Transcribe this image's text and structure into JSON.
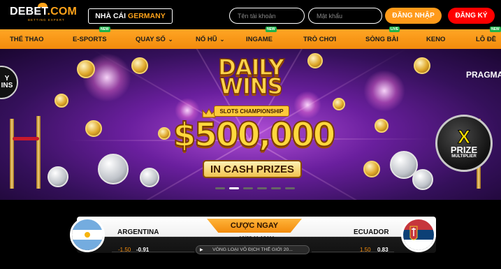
{
  "header": {
    "logo_main": "DEBET",
    "logo_suffix": ".COM",
    "logo_tagline": "BETTING EXPERT",
    "brand_prefix": "NHÀ CÁI",
    "brand_highlight": "GERMANY",
    "username_placeholder": "Tên tài khoản",
    "password_placeholder": "Mật khẩu",
    "login_label": "ĐĂNG NHẬP",
    "register_label": "ĐĂNG KÝ"
  },
  "nav": {
    "items": [
      {
        "label": "THỂ THAO",
        "badge": ""
      },
      {
        "label": "E-SPORTS",
        "badge": "NEW"
      },
      {
        "label": "QUAY SỐ",
        "badge": ""
      },
      {
        "label": "NỔ HŨ",
        "badge": ""
      },
      {
        "label": "INGAME",
        "badge": "NEW"
      },
      {
        "label": "TRÒ CHƠI",
        "badge": ""
      },
      {
        "label": "SÒNG BÀI",
        "badge": "LIVE"
      },
      {
        "label": "KENO",
        "badge": ""
      },
      {
        "label": "LÔ ĐỀ",
        "badge": "NEW"
      }
    ]
  },
  "banner": {
    "headline": "DAILY WINS",
    "subtitle": "SLOTS CHAMPIONSHIP",
    "amount": "$500,000",
    "cta": "IN CASH PRIZES",
    "prize_x": "X",
    "prize_word": "PRIZE",
    "prize_mult": "MULTIPLIER",
    "partner": "PRAGMA",
    "left_logo": "Y\nINS",
    "slide_count": 6,
    "active_slide": 1
  },
  "match": {
    "cta": "CƯỢC NGAY",
    "home_team": "ARGENTINA",
    "away_team": "ECUADOR",
    "datetime": "10/09 11:10AM",
    "league": "VÒNG LOẠI VÔ ĐỊCH THẾ GIỚI 20...",
    "home_handicap": "-1.50",
    "home_odds": "-0.91",
    "away_handicap": "1.50",
    "away_odds": "0.83"
  },
  "colors": {
    "accent": "#f28b0c",
    "register": "#ff0000",
    "banner_purple": "#6a1f9e"
  }
}
